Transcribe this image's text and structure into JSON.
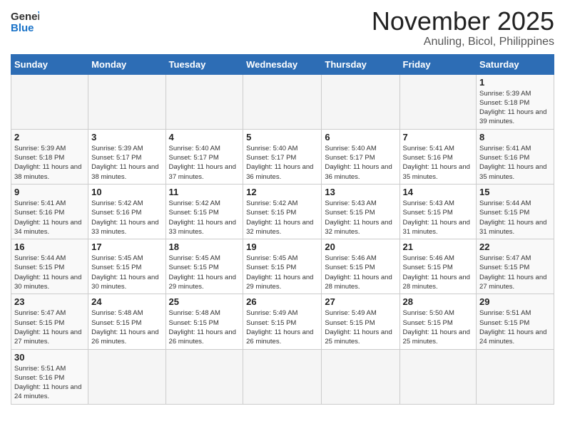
{
  "logo": {
    "general": "General",
    "blue": "Blue"
  },
  "header": {
    "month": "November 2025",
    "location": "Anuling, Bicol, Philippines"
  },
  "weekdays": [
    "Sunday",
    "Monday",
    "Tuesday",
    "Wednesday",
    "Thursday",
    "Friday",
    "Saturday"
  ],
  "weeks": [
    [
      {
        "day": "",
        "empty": true
      },
      {
        "day": "",
        "empty": true
      },
      {
        "day": "",
        "empty": true
      },
      {
        "day": "",
        "empty": true
      },
      {
        "day": "",
        "empty": true
      },
      {
        "day": "",
        "empty": true
      },
      {
        "day": "1",
        "sunrise": "5:39 AM",
        "sunset": "5:18 PM",
        "daylight": "11 hours and 39 minutes."
      }
    ],
    [
      {
        "day": "2",
        "sunrise": "5:39 AM",
        "sunset": "5:18 PM",
        "daylight": "11 hours and 38 minutes."
      },
      {
        "day": "3",
        "sunrise": "5:39 AM",
        "sunset": "5:17 PM",
        "daylight": "11 hours and 38 minutes."
      },
      {
        "day": "4",
        "sunrise": "5:40 AM",
        "sunset": "5:17 PM",
        "daylight": "11 hours and 37 minutes."
      },
      {
        "day": "5",
        "sunrise": "5:40 AM",
        "sunset": "5:17 PM",
        "daylight": "11 hours and 36 minutes."
      },
      {
        "day": "6",
        "sunrise": "5:40 AM",
        "sunset": "5:17 PM",
        "daylight": "11 hours and 36 minutes."
      },
      {
        "day": "7",
        "sunrise": "5:41 AM",
        "sunset": "5:16 PM",
        "daylight": "11 hours and 35 minutes."
      },
      {
        "day": "8",
        "sunrise": "5:41 AM",
        "sunset": "5:16 PM",
        "daylight": "11 hours and 35 minutes."
      }
    ],
    [
      {
        "day": "9",
        "sunrise": "5:41 AM",
        "sunset": "5:16 PM",
        "daylight": "11 hours and 34 minutes."
      },
      {
        "day": "10",
        "sunrise": "5:42 AM",
        "sunset": "5:16 PM",
        "daylight": "11 hours and 33 minutes."
      },
      {
        "day": "11",
        "sunrise": "5:42 AM",
        "sunset": "5:15 PM",
        "daylight": "11 hours and 33 minutes."
      },
      {
        "day": "12",
        "sunrise": "5:42 AM",
        "sunset": "5:15 PM",
        "daylight": "11 hours and 32 minutes."
      },
      {
        "day": "13",
        "sunrise": "5:43 AM",
        "sunset": "5:15 PM",
        "daylight": "11 hours and 32 minutes."
      },
      {
        "day": "14",
        "sunrise": "5:43 AM",
        "sunset": "5:15 PM",
        "daylight": "11 hours and 31 minutes."
      },
      {
        "day": "15",
        "sunrise": "5:44 AM",
        "sunset": "5:15 PM",
        "daylight": "11 hours and 31 minutes."
      }
    ],
    [
      {
        "day": "16",
        "sunrise": "5:44 AM",
        "sunset": "5:15 PM",
        "daylight": "11 hours and 30 minutes."
      },
      {
        "day": "17",
        "sunrise": "5:45 AM",
        "sunset": "5:15 PM",
        "daylight": "11 hours and 30 minutes."
      },
      {
        "day": "18",
        "sunrise": "5:45 AM",
        "sunset": "5:15 PM",
        "daylight": "11 hours and 29 minutes."
      },
      {
        "day": "19",
        "sunrise": "5:45 AM",
        "sunset": "5:15 PM",
        "daylight": "11 hours and 29 minutes."
      },
      {
        "day": "20",
        "sunrise": "5:46 AM",
        "sunset": "5:15 PM",
        "daylight": "11 hours and 28 minutes."
      },
      {
        "day": "21",
        "sunrise": "5:46 AM",
        "sunset": "5:15 PM",
        "daylight": "11 hours and 28 minutes."
      },
      {
        "day": "22",
        "sunrise": "5:47 AM",
        "sunset": "5:15 PM",
        "daylight": "11 hours and 27 minutes."
      }
    ],
    [
      {
        "day": "23",
        "sunrise": "5:47 AM",
        "sunset": "5:15 PM",
        "daylight": "11 hours and 27 minutes."
      },
      {
        "day": "24",
        "sunrise": "5:48 AM",
        "sunset": "5:15 PM",
        "daylight": "11 hours and 26 minutes."
      },
      {
        "day": "25",
        "sunrise": "5:48 AM",
        "sunset": "5:15 PM",
        "daylight": "11 hours and 26 minutes."
      },
      {
        "day": "26",
        "sunrise": "5:49 AM",
        "sunset": "5:15 PM",
        "daylight": "11 hours and 26 minutes."
      },
      {
        "day": "27",
        "sunrise": "5:49 AM",
        "sunset": "5:15 PM",
        "daylight": "11 hours and 25 minutes."
      },
      {
        "day": "28",
        "sunrise": "5:50 AM",
        "sunset": "5:15 PM",
        "daylight": "11 hours and 25 minutes."
      },
      {
        "day": "29",
        "sunrise": "5:51 AM",
        "sunset": "5:15 PM",
        "daylight": "11 hours and 24 minutes."
      }
    ],
    [
      {
        "day": "30",
        "sunrise": "5:51 AM",
        "sunset": "5:16 PM",
        "daylight": "11 hours and 24 minutes."
      },
      {
        "day": "",
        "empty": true
      },
      {
        "day": "",
        "empty": true
      },
      {
        "day": "",
        "empty": true
      },
      {
        "day": "",
        "empty": true
      },
      {
        "day": "",
        "empty": true
      },
      {
        "day": "",
        "empty": true
      }
    ]
  ],
  "labels": {
    "sunrise": "Sunrise:",
    "sunset": "Sunset:",
    "daylight": "Daylight:"
  },
  "colors": {
    "header_bg": "#2d6db5",
    "accent": "#1a73c8"
  }
}
